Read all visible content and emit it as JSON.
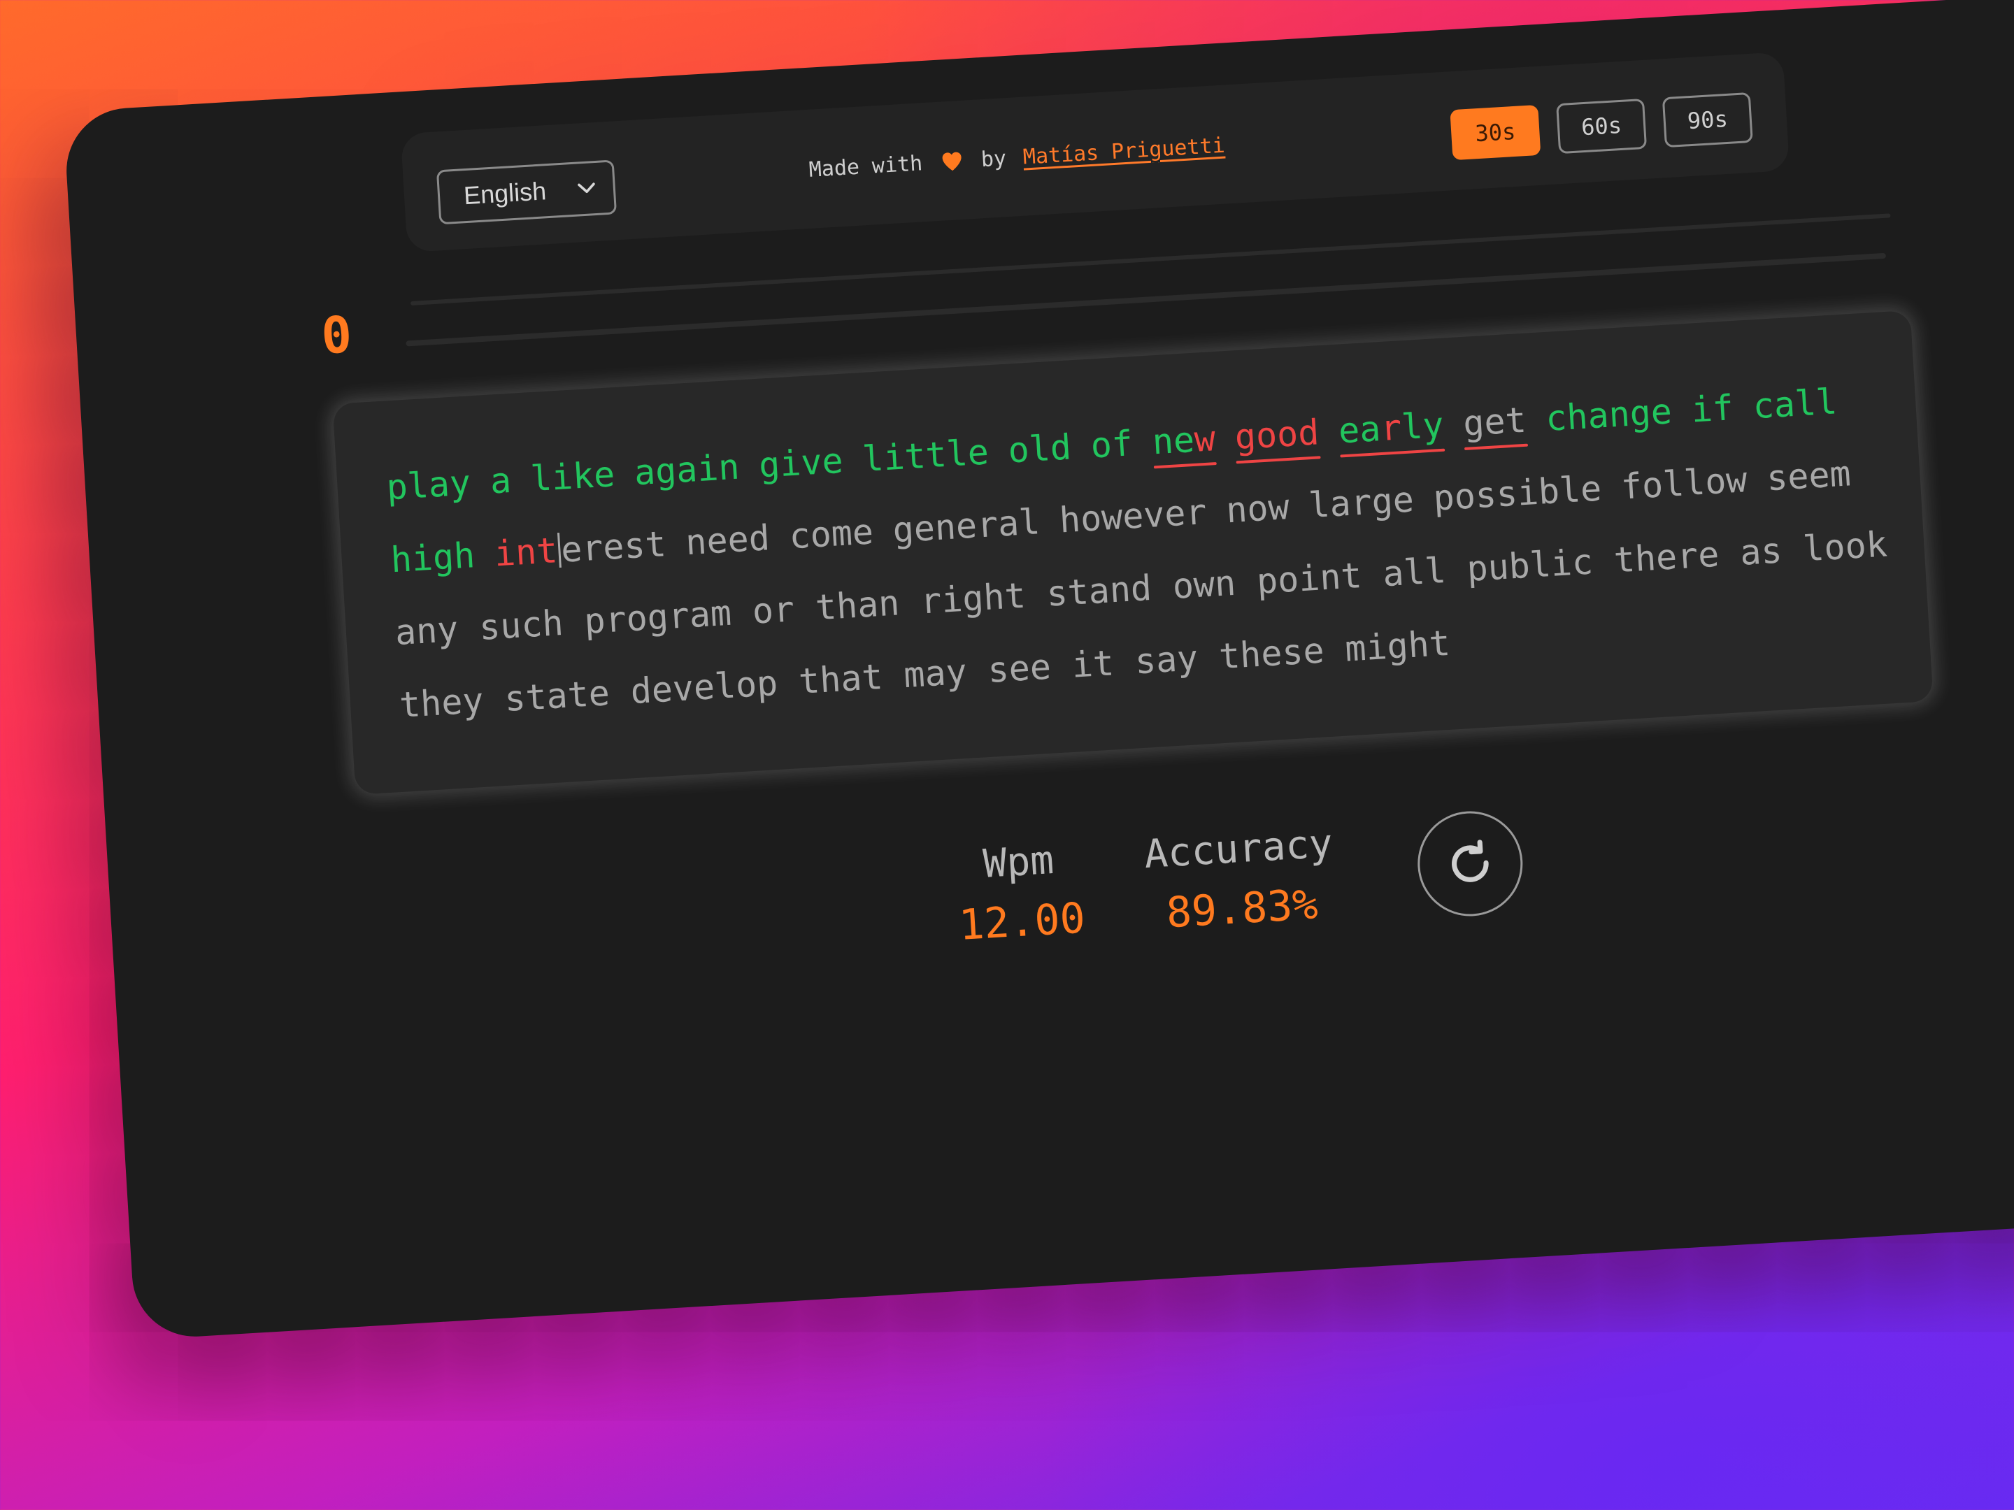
{
  "header": {
    "language": "English",
    "made_with": "Made with",
    "by": "by",
    "author": "Matías Priguetti",
    "time_options": [
      "30s",
      "60s",
      "90s"
    ],
    "active_time": "30s"
  },
  "counter": "0",
  "text": {
    "line1": [
      {
        "text": "play",
        "state": "correct"
      },
      {
        "text": "a",
        "state": "correct"
      },
      {
        "text": "like",
        "state": "correct"
      },
      {
        "text": "again",
        "state": "correct"
      },
      {
        "text": "give",
        "state": "correct"
      },
      {
        "text": "little",
        "state": "correct"
      },
      {
        "text": "old",
        "state": "correct"
      },
      {
        "text": "of",
        "state": "correct"
      },
      {
        "text": "new",
        "state": "mixed"
      },
      {
        "text": "good",
        "state": "incorrect"
      },
      {
        "text": "early",
        "state": "mixed"
      },
      {
        "text": "get",
        "state": "pending-error"
      },
      {
        "text": "change",
        "state": "correct"
      },
      {
        "text": "if",
        "state": "correct"
      },
      {
        "text": "call",
        "state": "correct"
      }
    ],
    "line2": [
      {
        "text": "high",
        "state": "correct"
      },
      {
        "text": "interest",
        "state": "active"
      },
      {
        "text": "need",
        "state": "pending"
      },
      {
        "text": "come",
        "state": "pending"
      },
      {
        "text": "general",
        "state": "pending"
      },
      {
        "text": "however",
        "state": "pending"
      },
      {
        "text": "now",
        "state": "pending"
      },
      {
        "text": "large",
        "state": "pending"
      },
      {
        "text": "possible",
        "state": "pending"
      },
      {
        "text": "follow",
        "state": "pending"
      },
      {
        "text": "seem",
        "state": "pending"
      }
    ],
    "line3": "any such program or than right stand own point all public there as look",
    "line4": "they state develop that may see it say these might"
  },
  "stats": {
    "wpm_label": "Wpm",
    "wpm_value": "12.00",
    "accuracy_label": "Accuracy",
    "accuracy_value": "89.83%"
  },
  "colors": {
    "accent": "#ff7a1f",
    "correct": "#22c55e",
    "incorrect": "#ef4444",
    "pending": "#a8a8a8",
    "window_bg": "#1c1c1c"
  },
  "icons": {
    "language_chevron": "chevron-down-icon",
    "heart": "heart-icon",
    "restart": "restart-icon"
  }
}
